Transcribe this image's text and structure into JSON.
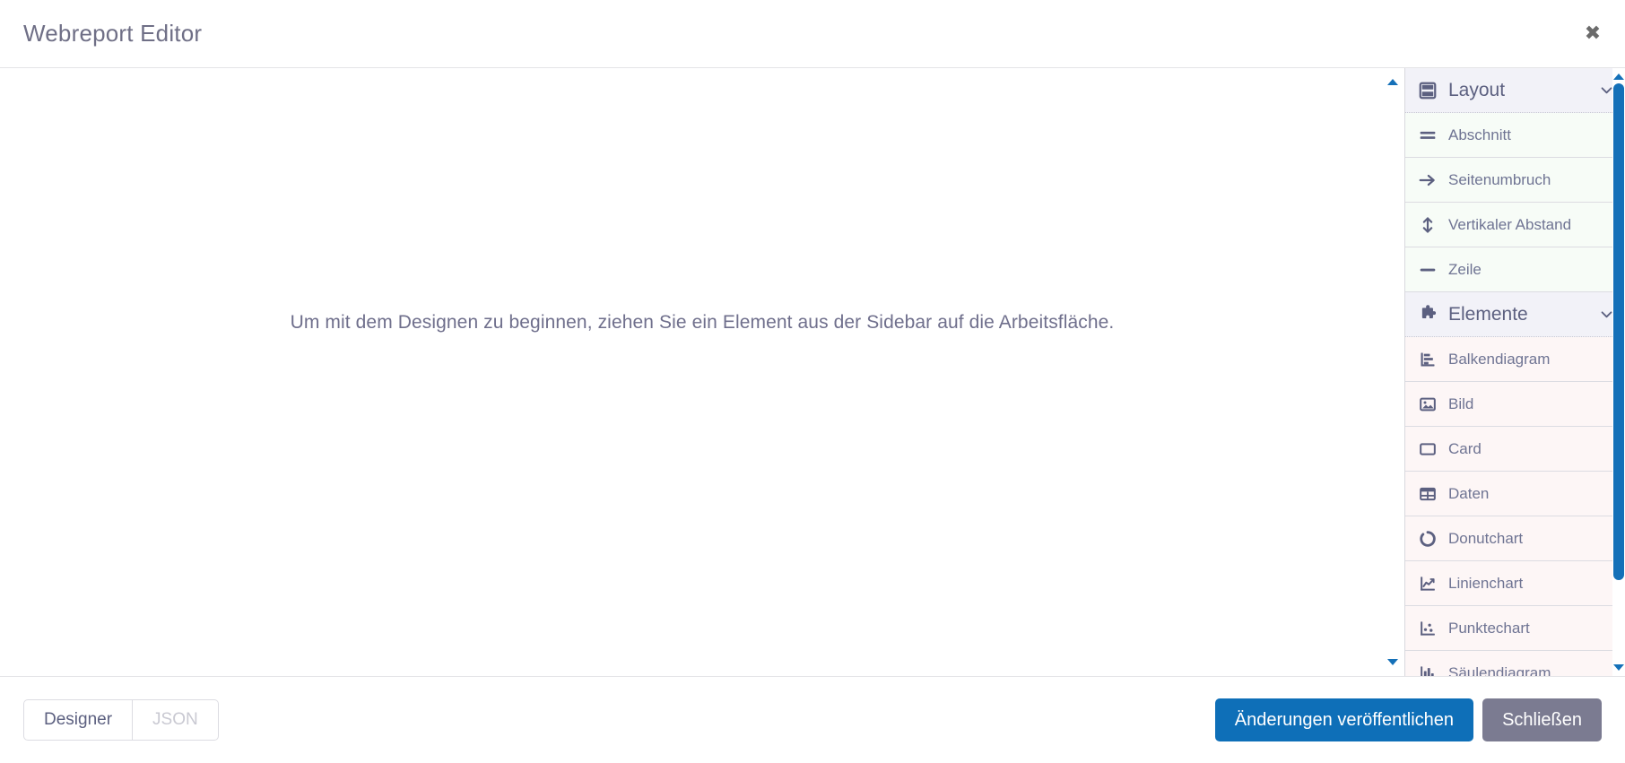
{
  "header": {
    "title": "Webreport Editor",
    "close_label": "✖"
  },
  "canvas": {
    "hint": "Um mit dem Designen zu beginnen, ziehen Sie ein Element aus der Sidebar auf die Arbeitsfläche."
  },
  "sidebar": {
    "sections": [
      {
        "id": "layout",
        "label": "Layout",
        "icon": "layout-icon",
        "chevron": "chevron-down-icon",
        "items": [
          {
            "label": "Abschnitt",
            "icon": "section-icon"
          },
          {
            "label": "Seitenumbruch",
            "icon": "arrow-right-icon"
          },
          {
            "label": "Vertikaler Abstand",
            "icon": "arrows-vertical-icon"
          },
          {
            "label": "Zeile",
            "icon": "minus-icon"
          }
        ]
      },
      {
        "id": "elemente",
        "label": "Elemente",
        "icon": "puzzle-piece-icon",
        "chevron": "chevron-down-icon",
        "items": [
          {
            "label": "Balkendiagram",
            "icon": "bar-chart-horizontal-icon"
          },
          {
            "label": "Bild",
            "icon": "image-icon"
          },
          {
            "label": "Card",
            "icon": "square-icon"
          },
          {
            "label": "Daten",
            "icon": "table-icon"
          },
          {
            "label": "Donutchart",
            "icon": "donut-chart-icon"
          },
          {
            "label": "Linienchart",
            "icon": "line-chart-icon"
          },
          {
            "label": "Punktechart",
            "icon": "scatter-chart-icon"
          },
          {
            "label": "Säulendiagram",
            "icon": "column-chart-icon"
          }
        ]
      }
    ]
  },
  "footer": {
    "view_toggle": {
      "designer": "Designer",
      "json": "JSON"
    },
    "publish_label": "Änderungen veröffentlichen",
    "close_label": "Schließen"
  },
  "colors": {
    "primary": "#0e6fb8",
    "secondary": "#7b7b91",
    "scrollbar": "#1470b8",
    "title": "#6f6f86",
    "icon": "#5c6080"
  }
}
